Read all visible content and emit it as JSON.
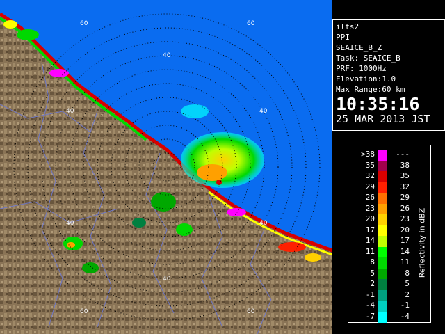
{
  "info": {
    "site": "ilts2",
    "scan": "PPI",
    "product": "SEAICE_B_Z",
    "task": "Task: SEAICE_B",
    "prf": "PRF: 1000Hz",
    "elevation": "Elevation:1.0",
    "max_range": "Max Range:60 km",
    "time": "10:35:16",
    "date": "25 MAR 2013 JST"
  },
  "rings": {
    "labels": [
      "40",
      "60"
    ]
  },
  "legend": {
    "unit": "Reflectivity in dBZ",
    "rows": [
      {
        "lo": ">38",
        "hi": "---",
        "color": "#ff00ff"
      },
      {
        "lo": "35",
        "hi": "38",
        "color": "#a0004c"
      },
      {
        "lo": "32",
        "hi": "35",
        "color": "#d80000"
      },
      {
        "lo": "29",
        "hi": "32",
        "color": "#ff2000"
      },
      {
        "lo": "26",
        "hi": "29",
        "color": "#ff7000"
      },
      {
        "lo": "23",
        "hi": "26",
        "color": "#ffa000"
      },
      {
        "lo": "20",
        "hi": "23",
        "color": "#ffd000"
      },
      {
        "lo": "17",
        "hi": "20",
        "color": "#ffff00"
      },
      {
        "lo": "14",
        "hi": "17",
        "color": "#c0ff00"
      },
      {
        "lo": "11",
        "hi": "14",
        "color": "#00ff00"
      },
      {
        "lo": "8",
        "hi": "11",
        "color": "#00d800"
      },
      {
        "lo": "5",
        "hi": "8",
        "color": "#00a800"
      },
      {
        "lo": "2",
        "hi": "5",
        "color": "#008040"
      },
      {
        "lo": "-1",
        "hi": "2",
        "color": "#00a080"
      },
      {
        "lo": "-4",
        "hi": "-1",
        "color": "#00d0c0"
      },
      {
        "lo": "-7",
        "hi": "-4",
        "color": "#00ffff"
      }
    ]
  },
  "colors": {
    "sea": "#0a6cf0",
    "land": "#8a7456",
    "land_dark": "#6a573e",
    "rivers": "#6f78c8"
  }
}
